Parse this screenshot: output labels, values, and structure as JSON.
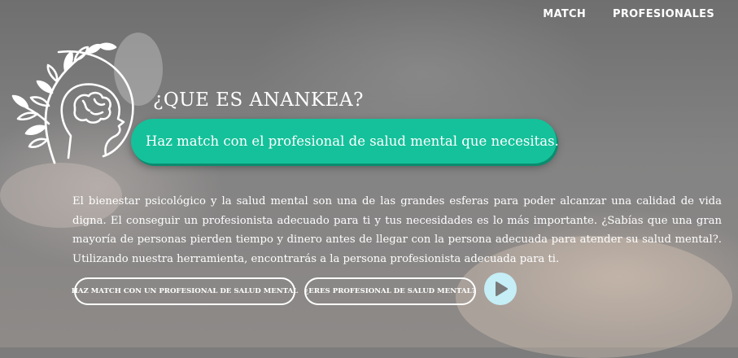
{
  "nav": {
    "items": [
      "MATCH",
      "PROFESIONALES"
    ]
  },
  "hero": {
    "title": "¿QUE ES ANANKEA?",
    "tagline": "Haz match con el profesional de salud mental que necesitas.",
    "description": "El bienestar psicológico y la salud mental son una de las grandes esferas para poder alcanzar una calidad de vida digna. El conseguir un profesionista adecuado para ti y tus necesidades es lo más importante. ¿Sabías que una gran mayoría de personas pierden tiempo y dinero antes de llegar con la persona adecuada para atender su salud mental?. Utilizando nuestra herramienta, encontrarás a la persona profesionista adecuada para ti."
  },
  "buttons": {
    "match": "HAZ MATCH CON UN PROFESIONAL DE SALUD MENTAL",
    "professional": "¿ERES PROFESIONAL DE SALUD MENTAL?"
  },
  "icons": {
    "logo": "head-brain-leaves-logo",
    "play": "play-icon"
  },
  "colors": {
    "accent": "#14c19a",
    "play_bg": "#c5eef6",
    "text": "#ffffff"
  }
}
